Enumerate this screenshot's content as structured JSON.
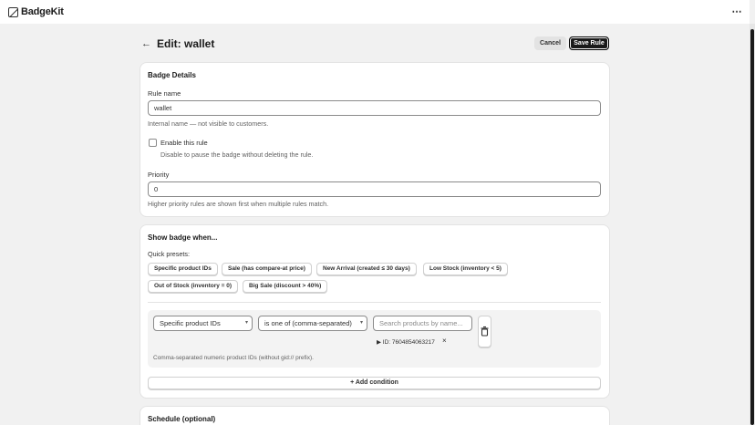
{
  "app": {
    "name": "BadgeKit",
    "menu_label": "⋯"
  },
  "header": {
    "back_icon": "←",
    "title": "Edit: wallet",
    "cancel_label": "Cancel",
    "save_label": "Save Rule"
  },
  "badge_details": {
    "title": "Badge Details",
    "rule_name_label": "Rule name",
    "rule_name_value": "wallet",
    "rule_name_help": "Internal name — not visible to customers.",
    "enable_label": "Enable this rule",
    "enable_checked": false,
    "enable_help": "Disable to pause the badge without deleting the rule.",
    "priority_label": "Priority",
    "priority_value": "0",
    "priority_help": "Higher priority rules are shown first when multiple rules match."
  },
  "show_when": {
    "title": "Show badge when...",
    "presets_label": "Quick presets:",
    "presets": [
      "Specific product IDs",
      "Sale (has compare-at price)",
      "New Arrival (created ≤ 30 days)",
      "Low Stock (inventory < 5)",
      "Out of Stock (inventory = 0)",
      "Big Sale (discount > 40%)"
    ],
    "condition": {
      "field": "Specific product IDs",
      "operator": "is one of (comma-separated)",
      "search_placeholder": "Search products by name...",
      "tag_label": "▶ ID: 7604854063217",
      "tag_remove": "×",
      "help": "Comma-separated numeric product IDs (without gid:// prefix)."
    },
    "add_condition_label": "+ Add condition"
  },
  "schedule": {
    "title": "Schedule (optional)"
  }
}
